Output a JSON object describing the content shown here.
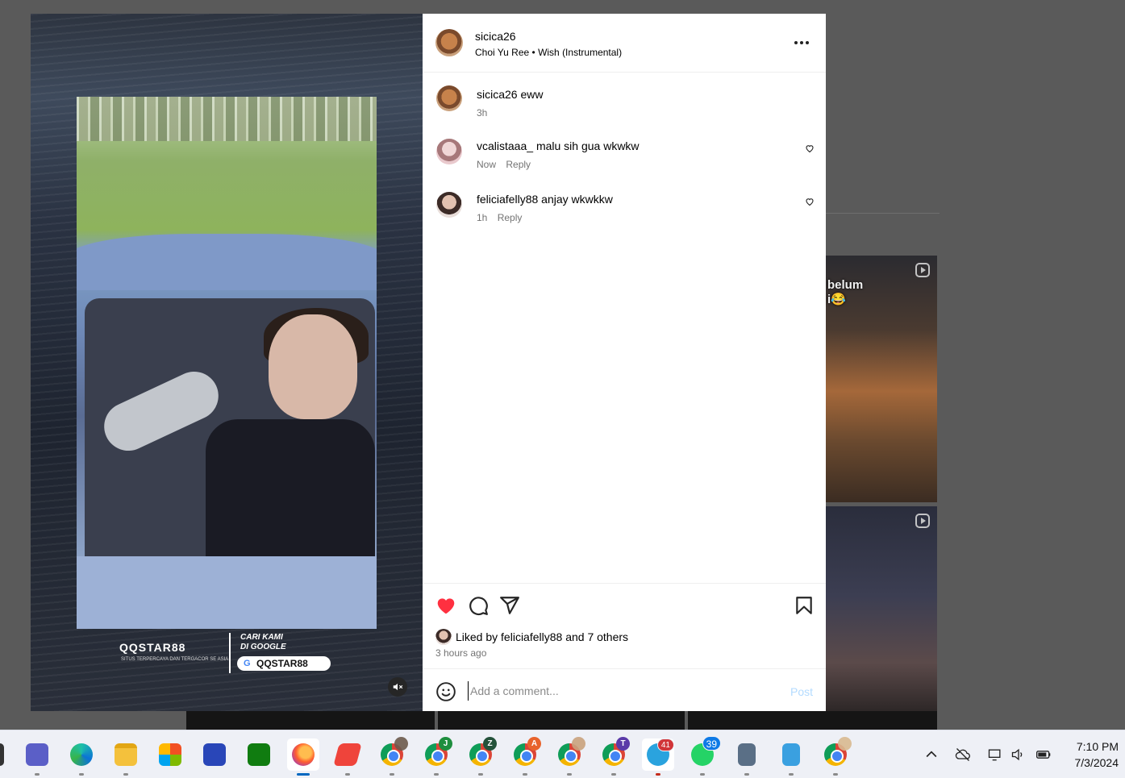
{
  "post": {
    "author": "sicica26",
    "audio_artist": "Choi Yu Ree",
    "audio_separator": "•",
    "audio_title": "Wish (Instrumental)"
  },
  "media": {
    "ad_logo": "QQSTAR88",
    "ad_tagline": "SITUS TERPERCAYA DAN TERGACOR SE ASIA",
    "ad_find_line1": "CARI KAMI",
    "ad_find_line2": "DI GOOGLE",
    "ad_search_pill": "QQSTAR88"
  },
  "comments": [
    {
      "user": "sicica26",
      "text": "eww",
      "time": "3h",
      "reply": ""
    },
    {
      "user": "vcalistaaa_",
      "text": "malu sih gua wkwkw",
      "time": "Now",
      "reply": "Reply"
    },
    {
      "user": "feliciafelly88",
      "text": "anjay wkwkkw",
      "time": "1h",
      "reply": "Reply"
    }
  ],
  "likes": {
    "prefix": "Liked by",
    "first_user": "feliciafelly88",
    "connector": "and",
    "others": "7 others",
    "time_ago": "3 hours ago"
  },
  "composer": {
    "placeholder": "Add a comment...",
    "post_label": "Post"
  },
  "background": {
    "caption_line1": "belum",
    "caption_line2": "i😂"
  },
  "taskbar": {
    "apps": [
      "teams-icon",
      "edge-icon",
      "file-explorer-icon",
      "store-icon",
      "vpn-icon",
      "xbox-icon",
      "firefox-icon",
      "anydesk-icon",
      "chrome-icon",
      "chrome-icon",
      "chrome-icon",
      "chrome-icon",
      "chrome-icon",
      "chrome-icon",
      "telegram-icon",
      "whatsapp-icon",
      "calculator-icon",
      "notepad-icon",
      "chrome-icon"
    ],
    "chrome_profiles": [
      "",
      "J",
      "Z",
      "A",
      "",
      "T",
      ""
    ],
    "telegram_badge": "41",
    "whatsapp_badge": "39",
    "time": "7:10 PM",
    "date": "7/3/2024"
  },
  "colors": {
    "like_red": "#ff3040",
    "post_disabled_blue": "#b3dbff",
    "muted_text": "#737373"
  }
}
